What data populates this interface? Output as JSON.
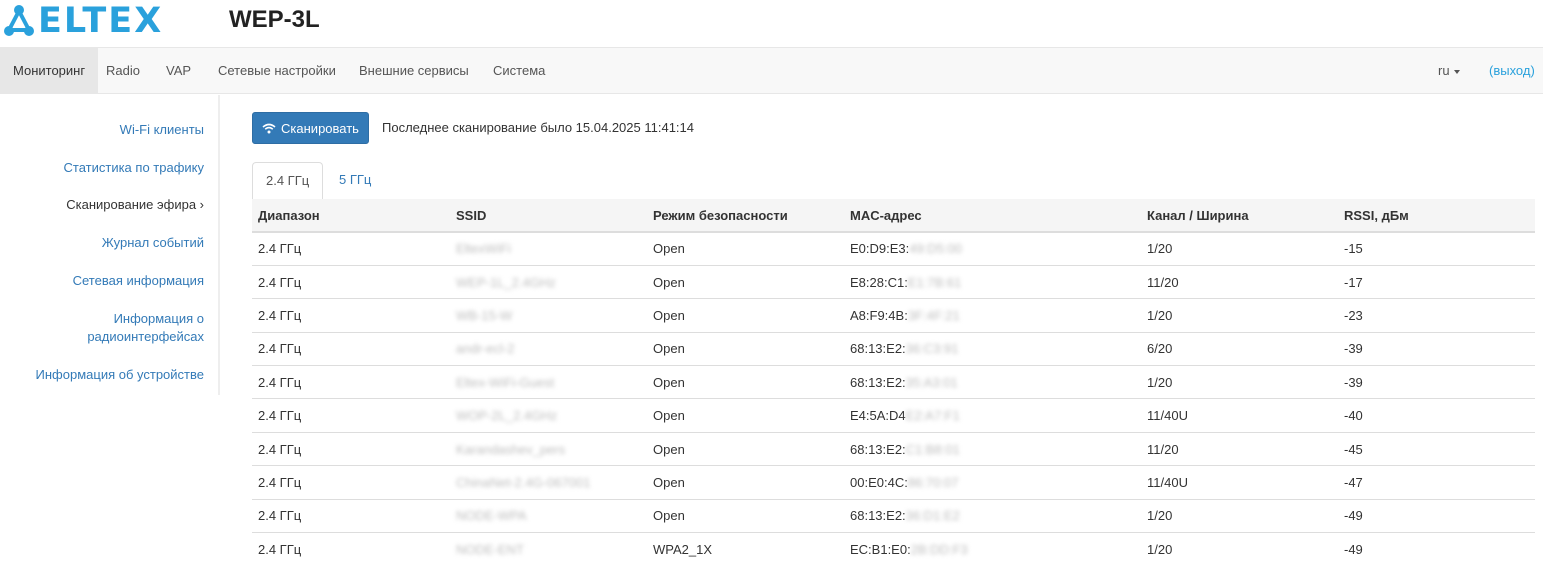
{
  "header": {
    "logo_text": "ELTEX",
    "product": "WEP-3L"
  },
  "navbar": {
    "items": [
      {
        "label": "Мониторинг"
      },
      {
        "label": "Radio"
      },
      {
        "label": "VAP"
      },
      {
        "label": "Сетевые настройки"
      },
      {
        "label": "Внешние сервисы"
      },
      {
        "label": "Система"
      }
    ],
    "language": "ru",
    "logout": "(выход)"
  },
  "sidebar": {
    "items": [
      {
        "label": "Wi-Fi клиенты"
      },
      {
        "label": "Статистика по трафику"
      },
      {
        "label": "Сканирование эфира ›"
      },
      {
        "label": "Журнал событий"
      },
      {
        "label": "Сетевая информация"
      },
      {
        "label": "Информация о"
      },
      {
        "label": "Информация об устройстве"
      }
    ],
    "item_radio_line2": "радиоинтерфейсах"
  },
  "main": {
    "scan_button": "Сканировать",
    "last_scan": "Последнее сканирование было 15.04.2025 11:41:14",
    "tabs": [
      {
        "label": "2.4 ГГц"
      },
      {
        "label": "5 ГГц"
      }
    ],
    "table": {
      "headers": [
        "Диапазон",
        "SSID",
        "Режим безопасности",
        "MAC-адрес",
        "Канал / Ширина",
        "RSSI, дБм"
      ],
      "rows": [
        {
          "range": "2.4 ГГц",
          "ssid": "EltexWiFi",
          "security": "Open",
          "mac": "E0:D9:E3:",
          "mac_hidden": "49:D5:00",
          "channel": "1/20",
          "rssi": "-15"
        },
        {
          "range": "2.4 ГГц",
          "ssid": "WEP-1L_2.4GHz",
          "security": "Open",
          "mac": "E8:28:C1:",
          "mac_hidden": "E1:7B:61",
          "channel": "11/20",
          "rssi": "-17"
        },
        {
          "range": "2.4 ГГц",
          "ssid": "WB-15-W",
          "security": "Open",
          "mac": "A8:F9:4B:",
          "mac_hidden": "3F:4F:21",
          "channel": "1/20",
          "rssi": "-23"
        },
        {
          "range": "2.4 ГГц",
          "ssid": "andr-ecl-2",
          "security": "Open",
          "mac": "68:13:E2:",
          "mac_hidden": "36:C3:91",
          "channel": "6/20",
          "rssi": "-39"
        },
        {
          "range": "2.4 ГГц",
          "ssid": "Eltex-WiFi-Guest",
          "security": "Open",
          "mac": "68:13:E2:",
          "mac_hidden": "35:A3:01",
          "channel": "1/20",
          "rssi": "-39"
        },
        {
          "range": "2.4 ГГц",
          "ssid": "WOP-2L_2.4GHz",
          "security": "Open",
          "mac": "E4:5A:D4",
          "mac_hidden": "E2:A7:F1",
          "channel": "11/40U",
          "rssi": "-40"
        },
        {
          "range": "2.4 ГГц",
          "ssid": "Karandashev_pers",
          "security": "Open",
          "mac": "68:13:E2:",
          "mac_hidden": "C1:B8:01",
          "channel": "11/20",
          "rssi": "-45"
        },
        {
          "range": "2.4 ГГц",
          "ssid": "ChinaNet-2.4G-067001",
          "security": "Open",
          "mac": "00:E0:4C:",
          "mac_hidden": "86:70:07",
          "channel": "11/40U",
          "rssi": "-47"
        },
        {
          "range": "2.4 ГГц",
          "ssid": "NODE-WPA",
          "security": "Open",
          "mac": "68:13:E2:",
          "mac_hidden": "36:D1:E2",
          "channel": "1/20",
          "rssi": "-49"
        },
        {
          "range": "2.4 ГГц",
          "ssid": "NODE-ENT",
          "security": "WPA2_1X",
          "mac": "EC:B1:E0:",
          "mac_hidden": "2B:DD:F3",
          "channel": "1/20",
          "rssi": "-49"
        }
      ]
    }
  },
  "colors": {
    "brand": "#2aa1dc",
    "primary_button": "#337ab7",
    "link": "#337ab7"
  }
}
